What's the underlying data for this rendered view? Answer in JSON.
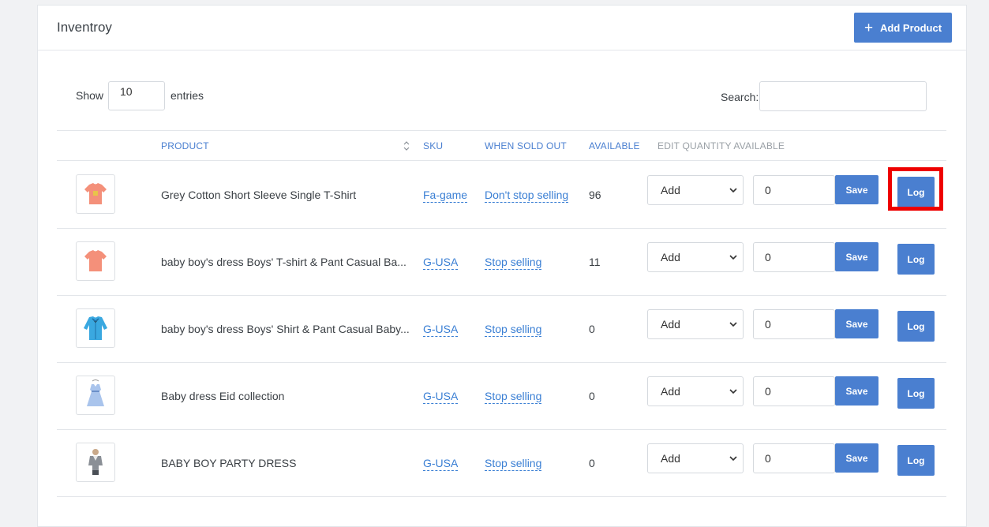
{
  "header": {
    "title": "Inventroy",
    "add_button_label": "Add Product"
  },
  "controls": {
    "show_label": "Show",
    "entries_value": "10",
    "entries_label": "entries",
    "search_label": "Search:",
    "search_value": ""
  },
  "table": {
    "columns": {
      "product": "PRODUCT",
      "sku": "SKU",
      "when_sold_out": "WHEN SOLD OUT",
      "available": "AVAILABLE",
      "edit_quantity": "EDIT QUANTITY AVAILABLE"
    },
    "rows": [
      {
        "product": "Grey Cotton Short Sleeve Single T-Shirt",
        "sku": "Fa-game",
        "when_sold_out": "Don't stop selling",
        "available": "96",
        "action": "Add",
        "quantity": "0",
        "save_label": "Save",
        "log_label": "Log",
        "thumb_icon": "tshirt-icon",
        "thumb_color": "#f4907a"
      },
      {
        "product": "baby boy's dress Boys' T-shirt & Pant Casual Ba...",
        "sku": "G-USA",
        "when_sold_out": "Stop selling",
        "available": "11",
        "action": "Add",
        "quantity": "0",
        "save_label": "Save",
        "log_label": "Log",
        "thumb_icon": "tshirt-icon",
        "thumb_color": "#f4907a"
      },
      {
        "product": "baby boy's dress Boys' Shirt & Pant Casual Baby...",
        "sku": "G-USA",
        "when_sold_out": "Stop selling",
        "available": "0",
        "action": "Add",
        "quantity": "0",
        "save_label": "Save",
        "log_label": "Log",
        "thumb_icon": "shirt-icon",
        "thumb_color": "#3aa8e0"
      },
      {
        "product": "Baby dress Eid collection",
        "sku": "G-USA",
        "when_sold_out": "Stop selling",
        "available": "0",
        "action": "Add",
        "quantity": "0",
        "save_label": "Save",
        "log_label": "Log",
        "thumb_icon": "dress-icon",
        "thumb_color": "#a9c4ec"
      },
      {
        "product": "BABY BOY PARTY DRESS",
        "sku": "G-USA",
        "when_sold_out": "Stop selling",
        "available": "0",
        "action": "Add",
        "quantity": "0",
        "save_label": "Save",
        "log_label": "Log",
        "thumb_icon": "suit-icon",
        "thumb_color": "#8a8f96"
      }
    ]
  },
  "colors": {
    "accent": "#4a7fd0",
    "link": "#3a7fd4",
    "highlight": "#ee0000"
  }
}
